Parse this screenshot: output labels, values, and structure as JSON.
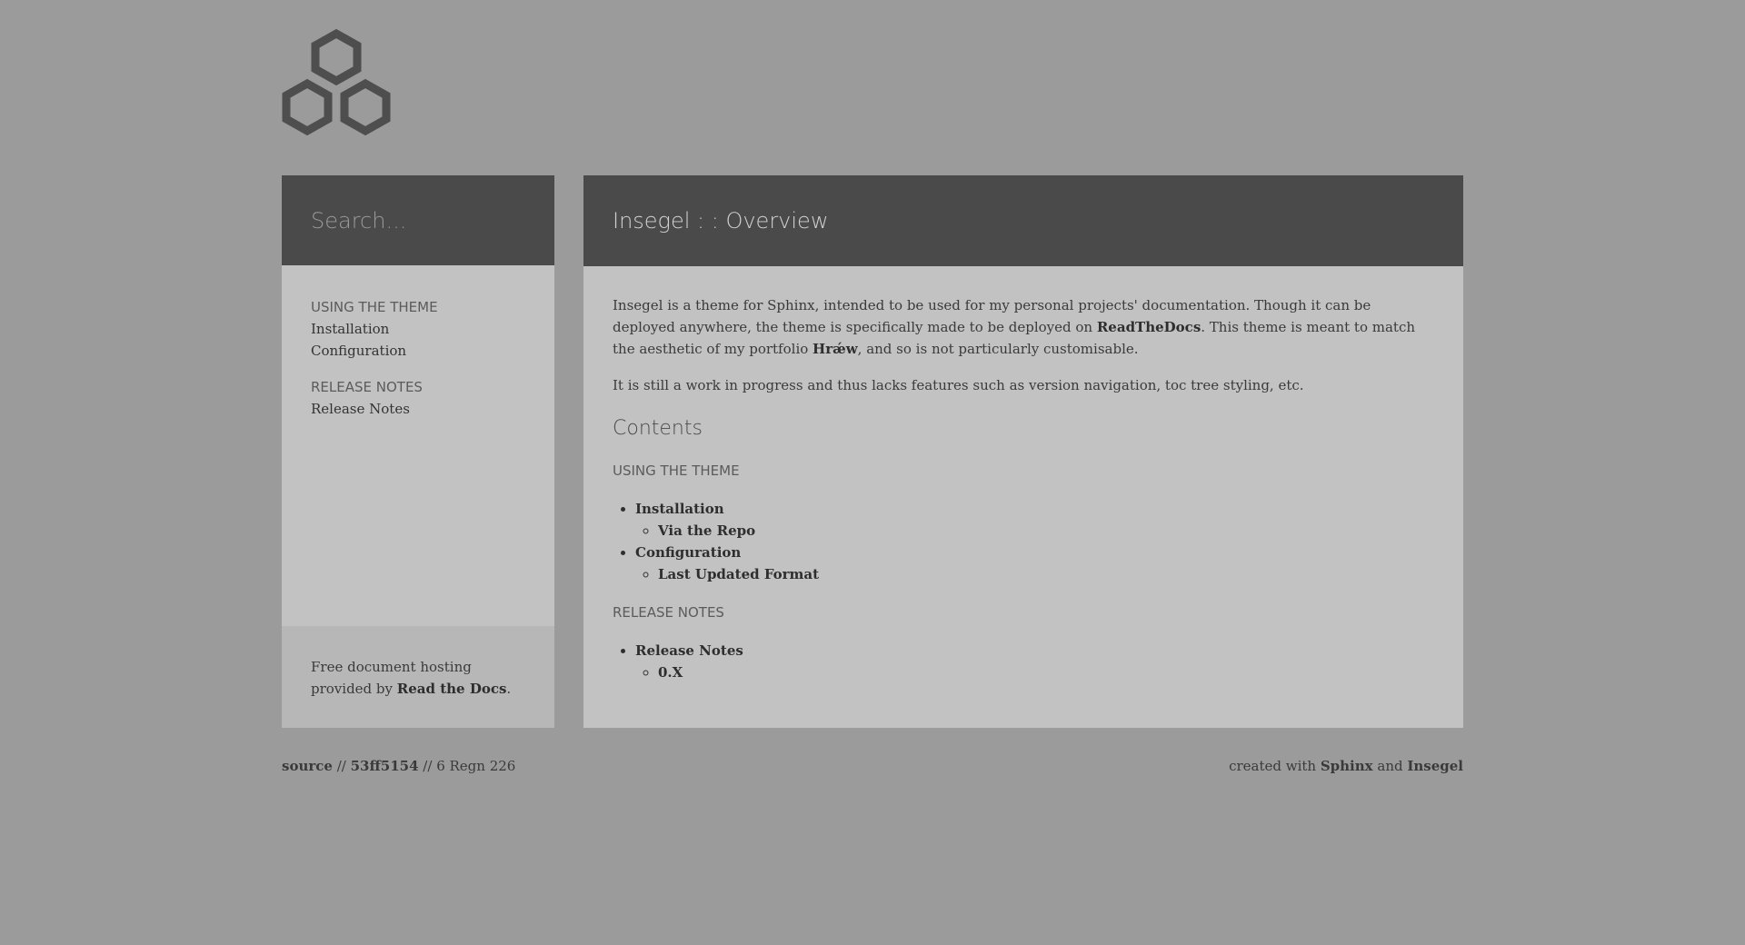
{
  "search": {
    "placeholder": "Search..."
  },
  "sidebar": {
    "sections": [
      {
        "caption": "USING THE THEME",
        "items": [
          "Installation",
          "Configuration"
        ]
      },
      {
        "caption": "RELEASE NOTES",
        "items": [
          "Release Notes"
        ]
      }
    ],
    "footer": {
      "text_before": "Free document hosting provided by ",
      "link": "Read the Docs",
      "text_after": "."
    }
  },
  "main": {
    "title": "Insegel : : Overview",
    "paragraph1": {
      "part1": "Insegel is a theme for Sphinx, intended to be used for my personal projects' documentation. Though it can be deployed anywhere, the theme is specifically made to be deployed on ",
      "link1": "ReadTheDocs",
      "part2": ". This theme is meant to match the aesthetic of my portfolio ",
      "link2": "Hrǽw",
      "part3": ", and so is not particularly customisable."
    },
    "paragraph2": "It is still a work in progress and thus lacks features such as version navigation, toc tree styling, etc.",
    "contents_title": "Contents",
    "sections": [
      {
        "caption": "USING THE THEME",
        "items": [
          {
            "label": "Installation",
            "children": [
              "Via the Repo"
            ]
          },
          {
            "label": "Configuration",
            "children": [
              "Last Updated Format"
            ]
          }
        ]
      },
      {
        "caption": "RELEASE NOTES",
        "items": [
          {
            "label": "Release Notes",
            "children": [
              "0.X"
            ]
          }
        ]
      }
    ]
  },
  "footer": {
    "source_label": "source",
    "sep1": " // ",
    "commit": "53ff5154",
    "sep2": " // ",
    "date": "6 Regn 226",
    "created_prefix": "created with ",
    "sphinx": "Sphinx",
    "and": " and ",
    "insegel": "Insegel"
  },
  "colors": {
    "background": "#9b9b9b",
    "panel": "#c2c2c2",
    "header": "#4a4a4a"
  }
}
